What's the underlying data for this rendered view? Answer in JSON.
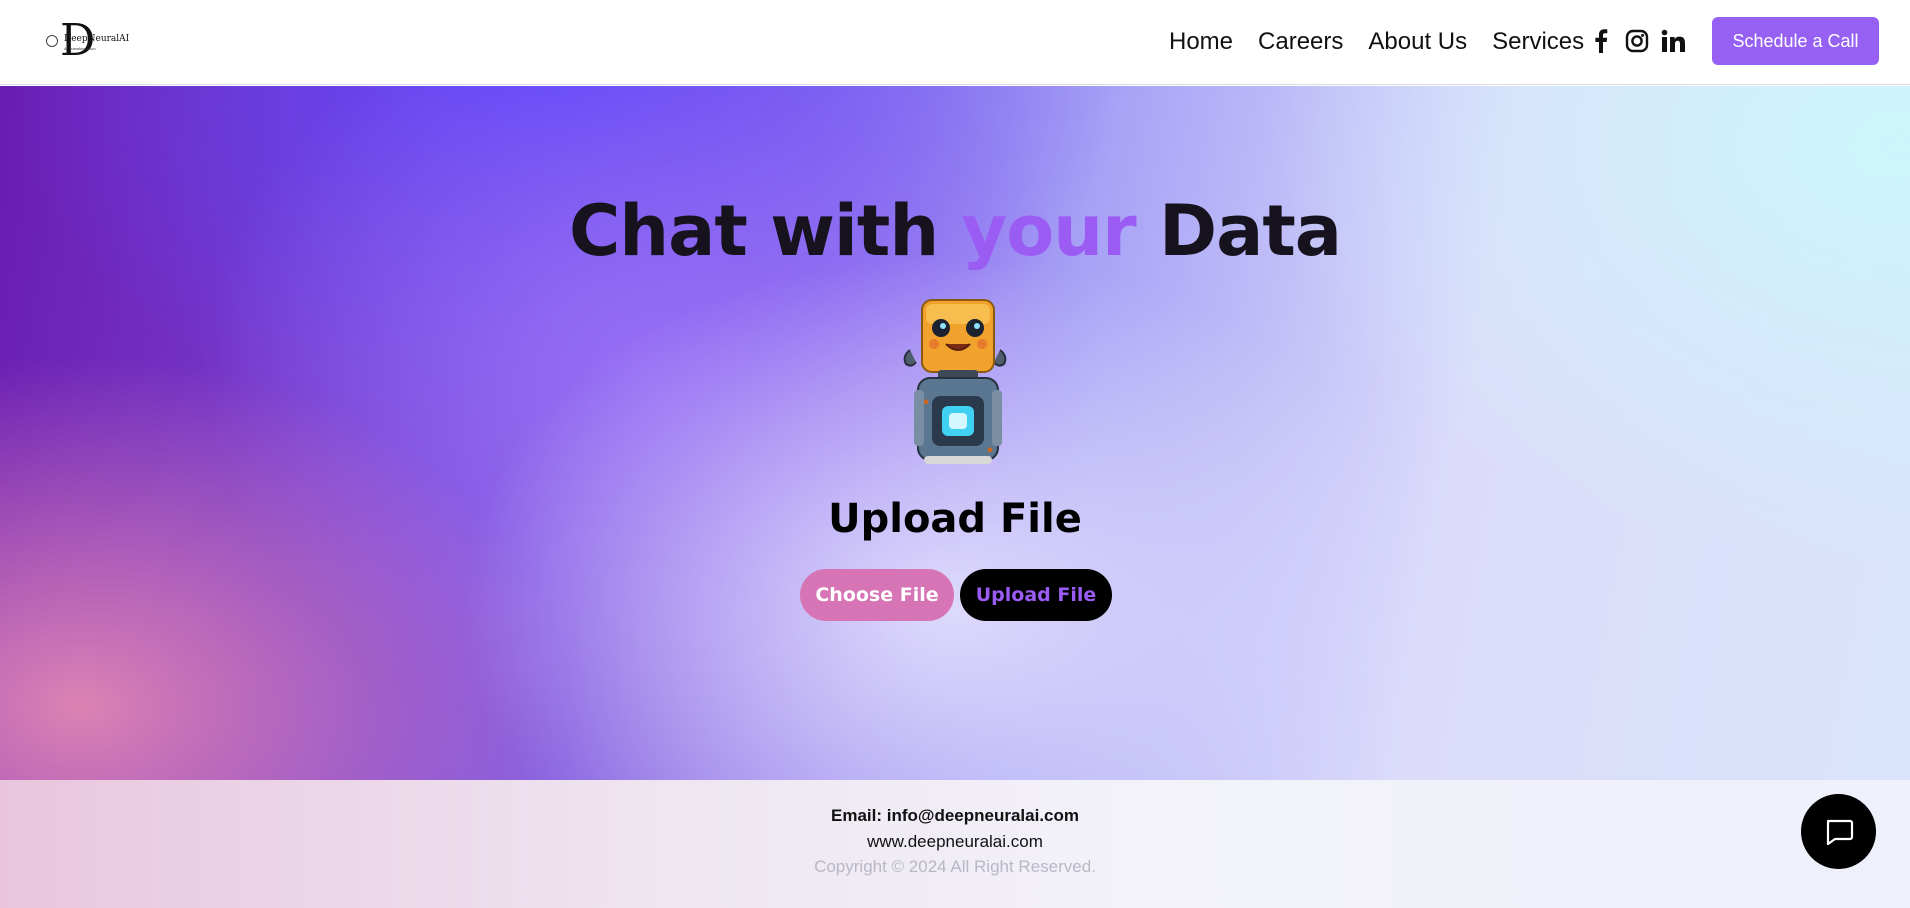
{
  "header": {
    "logo": {
      "mark": "D",
      "name": "DeepNeuralAI",
      "sub": "AI Transformation"
    },
    "nav": [
      {
        "label": "Home"
      },
      {
        "label": "Careers"
      },
      {
        "label": "About Us"
      },
      {
        "label": "Services"
      }
    ],
    "social_icons": [
      "facebook-icon",
      "instagram-icon",
      "linkedin-icon"
    ],
    "cta_label": "Schedule a Call"
  },
  "hero": {
    "title_part1": "Chat with ",
    "title_accent": "your",
    "title_part2": " Data",
    "mascot_icon": "robot-mascot",
    "upload_heading": "Upload File",
    "choose_button": "Choose File",
    "upload_button": "Upload File"
  },
  "footer": {
    "email": "Email: info@deepneuralai.com",
    "website": "www.deepneuralai.com",
    "copyright": "Copyright © 2024 All Right Reserved."
  },
  "chat_widget": {
    "icon": "chat-bubble-icon"
  },
  "colors": {
    "accent": "#9661f2",
    "title_accent": "#9b5cf4",
    "choose_button_bg": "#d674b6",
    "upload_button_bg": "#000000"
  }
}
